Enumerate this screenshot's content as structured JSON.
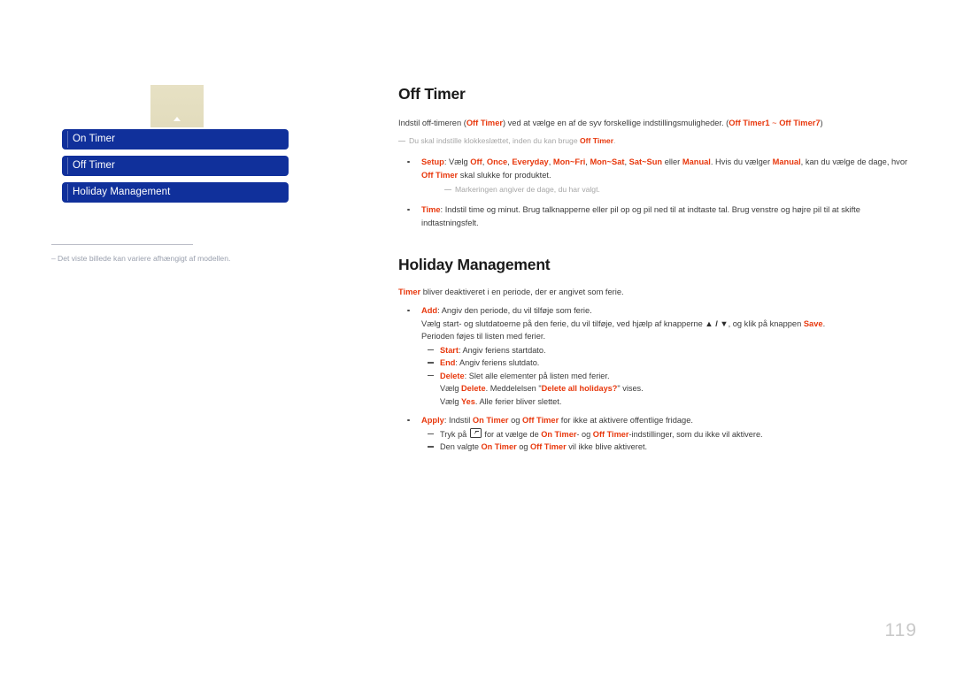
{
  "page": {
    "number": "119"
  },
  "illustration": {
    "screen_icon": "up-caret-icon",
    "menu_items": [
      {
        "label": "On Timer"
      },
      {
        "label": "Off Timer"
      },
      {
        "label": "Holiday Management"
      }
    ],
    "caption": "Det viste billede kan variere afhængigt af modellen.",
    "caption_dash": "‒"
  },
  "colors": {
    "accent_red": "#E8380D",
    "menu_blue": "#10309B",
    "note_gray": "#A7A7A7",
    "page_number_gray": "#C9C9C9",
    "screen_beige": "#E4DEC0"
  },
  "sections": [
    {
      "title": "Off Timer",
      "lead": {
        "p1": "Indstil off-timeren (",
        "k1": "Off Timer",
        "p2": ") ved at vælge en af de syv forskellige indstillingsmuligheder. (",
        "k2": "Off Timer1",
        "p3": " ~ ",
        "k3": "Off Timer7",
        "p4": ")"
      },
      "note": {
        "p1": "Du skal indstille klokkeslættet, inden du kan bruge ",
        "k1": "Off Timer",
        "p2": "."
      },
      "bullets": [
        {
          "key": "Setup",
          "sep": ": ",
          "t1": "Vælg ",
          "o1": "Off",
          "t2": ", ",
          "o2": "Once",
          "t3": ", ",
          "o3": "Everyday",
          "t4": ", ",
          "o4": "Mon~Fri",
          "t5": ", ",
          "o5": "Mon~Sat",
          "t6": ", ",
          "o6": "Sat~Sun",
          "t7": " eller ",
          "o7": "Manual",
          "t8": ". Hvis du vælger ",
          "o8": "Manual",
          "t9": ", kan du vælge de dage, hvor ",
          "o9": "Off Timer",
          "t10": " skal slukke for produktet.",
          "note": "Markeringen angiver de dage, du har valgt."
        },
        {
          "key": "Time",
          "sep": ": ",
          "text": "Indstil time og minut. Brug talknapperne eller pil op og pil ned til at indtaste tal. Brug venstre og højre pil til at skifte indtastningsfelt."
        }
      ]
    },
    {
      "title": "Holiday Management",
      "lead": {
        "k1": "Timer",
        "p1": " bliver deaktiveret i en periode, der er angivet som ferie."
      },
      "bullets": [
        {
          "key": "Add",
          "sep": ": ",
          "text": "Angiv den periode, du vil tilføje som ferie.",
          "line2_a": "Vælg start- og slutdatoerne på den ferie, du vil tilføje, ved hjælp af knapperne ",
          "line2_arrows": "▲ / ▼",
          "line2_b": ", og klik på knappen ",
          "line2_key": "Save",
          "line2_c": ".",
          "line3": "Perioden føjes til listen med ferier.",
          "subbullets": [
            {
              "key": "Start",
              "sep": ": ",
              "text": "Angiv feriens startdato."
            },
            {
              "key": "End",
              "sep": ": ",
              "text": "Angiv feriens slutdato."
            },
            {
              "key": "Delete",
              "sep": ": ",
              "text": "Slet alle elementer på listen med ferier.",
              "line2_a": "Vælg ",
              "line2_key1": "Delete",
              "line2_b": ". Meddelelsen \"",
              "line2_key2": "Delete all holidays?",
              "line2_c": "\" vises.",
              "line3_a": "Vælg ",
              "line3_key": "Yes",
              "line3_b": ". Alle ferier bliver slettet."
            }
          ]
        },
        {
          "key": "Apply",
          "sep": ": ",
          "t1": "Indstil ",
          "o1": "On Timer",
          "t2": " og ",
          "o2": "Off Timer",
          "t3": " for ikke at aktivere offentlige fridage.",
          "subbullets": [
            {
              "a": "Tryk på ",
              "icon": "enter-key-icon",
              "b": " for at vælge de ",
              "k1": "On Timer",
              "c": "- og ",
              "k2": "Off Timer",
              "d": "-indstillinger, som du ikke vil aktivere."
            },
            {
              "a": "Den valgte ",
              "k1": "On Timer",
              "b": " og ",
              "k2": "Off Timer",
              "c": " vil ikke blive aktiveret."
            }
          ]
        }
      ]
    }
  ]
}
